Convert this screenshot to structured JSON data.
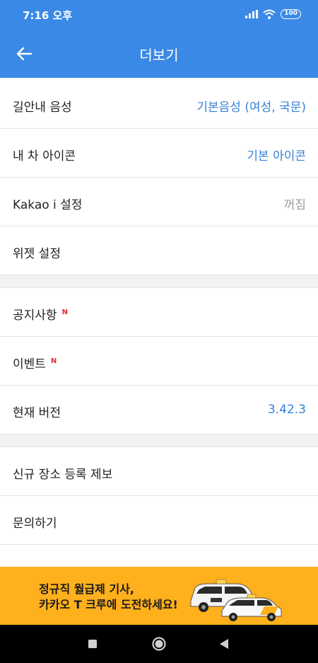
{
  "status_bar": {
    "time": "7:16 오후",
    "battery": "100"
  },
  "app_bar": {
    "title": "더보기"
  },
  "settings": {
    "voice": {
      "label": "길안내 음성",
      "value": "기본음성 (여성, 국문)"
    },
    "car_icon": {
      "label": "내 차 아이콘",
      "value": "기본 아이콘"
    },
    "kakao_i": {
      "label": "Kakao i 설정",
      "value": "꺼짐"
    },
    "widget": {
      "label": "위젯 설정"
    }
  },
  "info": {
    "notice": {
      "label": "공지사항",
      "badge": "N"
    },
    "event": {
      "label": "이벤트",
      "badge": "N"
    },
    "version": {
      "label": "현재 버전",
      "value": "3.42.3"
    }
  },
  "support": {
    "place_report": {
      "label": "신규 장소 등록 제보"
    },
    "inquiry": {
      "label": "문의하기"
    }
  },
  "banner": {
    "line1": "정규직 월급제 기사,",
    "line2": "카카오 T 크루에 도전하세요!"
  },
  "icons": {
    "back": "arrow-left-icon",
    "nav_recent": "square-icon",
    "nav_home": "circle-icon",
    "nav_back": "triangle-left-icon"
  },
  "colors": {
    "primary": "#3a89e6",
    "value_text": "#3581d8",
    "badge": "#e8262f",
    "banner_bg": "#ffb01d"
  }
}
